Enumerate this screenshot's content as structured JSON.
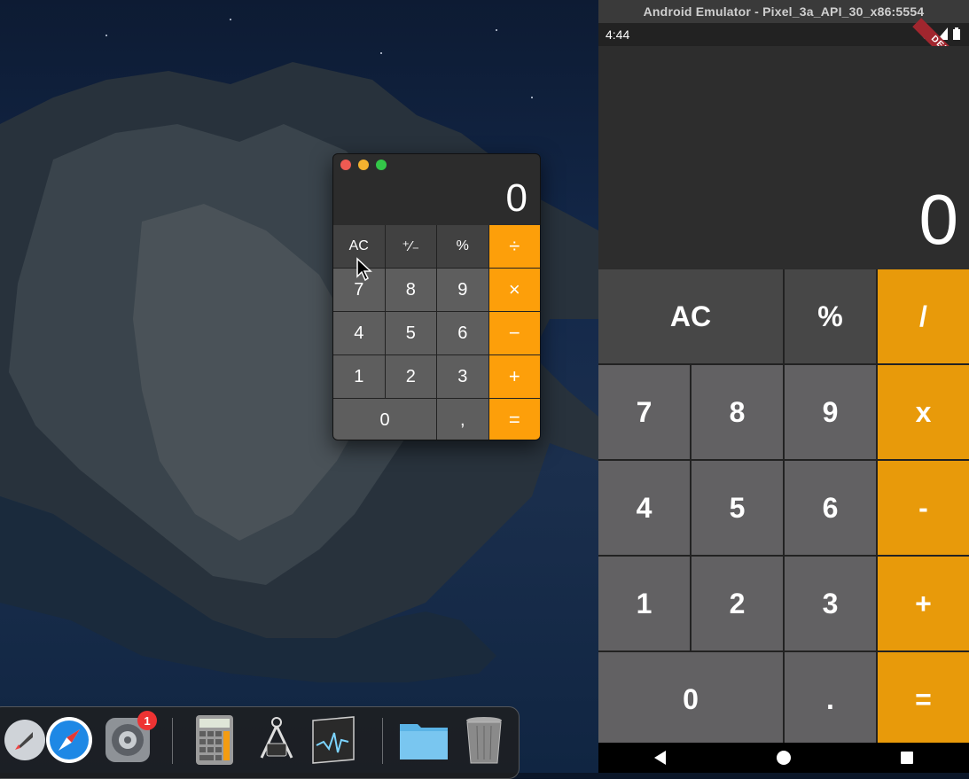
{
  "desktop": {
    "wallpaper": "catalina-island"
  },
  "mac_calculator": {
    "display": "0",
    "keys": [
      {
        "label": "AC",
        "kind": "fn"
      },
      {
        "label": "⁺∕₋",
        "kind": "fn"
      },
      {
        "label": "%",
        "kind": "fn"
      },
      {
        "label": "÷",
        "kind": "op"
      },
      {
        "label": "7",
        "kind": "num"
      },
      {
        "label": "8",
        "kind": "num"
      },
      {
        "label": "9",
        "kind": "num"
      },
      {
        "label": "×",
        "kind": "op"
      },
      {
        "label": "4",
        "kind": "num"
      },
      {
        "label": "5",
        "kind": "num"
      },
      {
        "label": "6",
        "kind": "num"
      },
      {
        "label": "−",
        "kind": "op"
      },
      {
        "label": "1",
        "kind": "num"
      },
      {
        "label": "2",
        "kind": "num"
      },
      {
        "label": "3",
        "kind": "num"
      },
      {
        "label": "+",
        "kind": "op"
      },
      {
        "label": "0",
        "kind": "num"
      },
      {
        "label": ",",
        "kind": "num"
      },
      {
        "label": "=",
        "kind": "op"
      }
    ]
  },
  "dock": {
    "icons": [
      "launchpad-icon",
      "safari-icon",
      "system-preferences-icon",
      "calculator-icon",
      "instruments-icon",
      "activity-monitor-icon",
      "downloads-folder-icon",
      "trash-icon"
    ],
    "badge": "1"
  },
  "emulator": {
    "title": "Android Emulator - Pixel_3a_API_30_x86:5554",
    "status_time": "4:44",
    "debug_label": "DEBUG",
    "display": "0",
    "keys": [
      {
        "label": "AC",
        "kind": "fn"
      },
      {
        "label": "%",
        "kind": "fn"
      },
      {
        "label": "/",
        "kind": "op"
      },
      {
        "label": "7",
        "kind": "num"
      },
      {
        "label": "8",
        "kind": "num"
      },
      {
        "label": "9",
        "kind": "num"
      },
      {
        "label": "x",
        "kind": "op"
      },
      {
        "label": "4",
        "kind": "num"
      },
      {
        "label": "5",
        "kind": "num"
      },
      {
        "label": "6",
        "kind": "num"
      },
      {
        "label": "-",
        "kind": "op"
      },
      {
        "label": "1",
        "kind": "num"
      },
      {
        "label": "2",
        "kind": "num"
      },
      {
        "label": "3",
        "kind": "num"
      },
      {
        "label": "+",
        "kind": "op"
      },
      {
        "label": "0",
        "kind": "num"
      },
      {
        "label": ".",
        "kind": "num"
      },
      {
        "label": "=",
        "kind": "op"
      }
    ],
    "nav": [
      "back-icon",
      "home-icon",
      "recents-icon"
    ]
  },
  "colors": {
    "mac_operator": "#fd9f0a",
    "android_operator": "#e89a0a",
    "badge": "#e33333"
  }
}
